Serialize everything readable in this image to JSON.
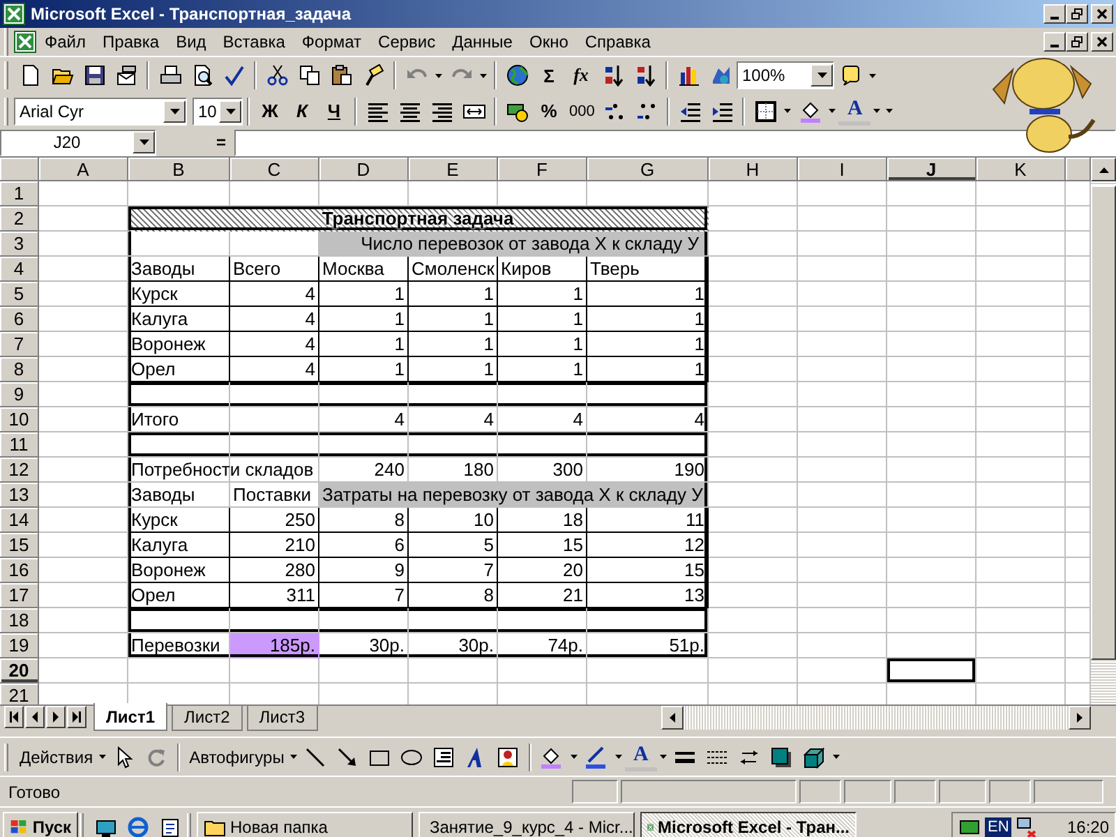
{
  "window": {
    "title": "Microsoft Excel - Транспортная_задача"
  },
  "menu": [
    "Файл",
    "Правка",
    "Вид",
    "Вставка",
    "Формат",
    "Сервис",
    "Данные",
    "Окно",
    "Справка"
  ],
  "standard_toolbar": {
    "sum": "Σ",
    "function": "fx",
    "zoom": "100%"
  },
  "formatting_toolbar": {
    "font": "Arial Cyr",
    "size": "10",
    "bold": "Ж",
    "italic": "К",
    "underline": "Ч",
    "percent": "%",
    "thousands": "000",
    "font_color": "A"
  },
  "formula_bar": {
    "name_box": "J20",
    "equals": "="
  },
  "columns": [
    {
      "label": "A",
      "selected": false
    },
    {
      "label": "B",
      "selected": false
    },
    {
      "label": "C",
      "selected": false
    },
    {
      "label": "D",
      "selected": false
    },
    {
      "label": "E",
      "selected": false
    },
    {
      "label": "F",
      "selected": false
    },
    {
      "label": "G",
      "selected": false
    },
    {
      "label": "H",
      "selected": false
    },
    {
      "label": "I",
      "selected": false
    },
    {
      "label": "J",
      "selected": true
    },
    {
      "label": "K",
      "selected": false
    }
  ],
  "rows": [
    {
      "label": "1",
      "selected": false,
      "kind": "plain",
      "cells": []
    },
    {
      "label": "2",
      "selected": false,
      "kind": "title",
      "cells": [
        {
          "t": "Транспортная задача",
          "kind": "title"
        }
      ]
    },
    {
      "label": "3",
      "selected": false,
      "kind": "total",
      "cells": [
        null,
        null,
        {
          "t": "Число перевозок от завода  Х к складу У",
          "kind": "band"
        }
      ]
    },
    {
      "label": "4",
      "selected": false,
      "kind": "body",
      "cells": [
        {
          "t": "Заводы"
        },
        {
          "t": "Всего"
        },
        {
          "t": "Москва"
        },
        {
          "t": "Смоленск"
        },
        {
          "t": "Киров"
        },
        {
          "t": "Тверь"
        }
      ]
    },
    {
      "label": "5",
      "selected": false,
      "kind": "body",
      "cells": [
        {
          "t": "Курск"
        },
        {
          "t": "4",
          "kind": "number"
        },
        {
          "t": "1",
          "kind": "number"
        },
        {
          "t": "1",
          "kind": "number"
        },
        {
          "t": "1",
          "kind": "number"
        },
        {
          "t": "1",
          "kind": "number"
        }
      ]
    },
    {
      "label": "6",
      "selected": false,
      "kind": "body",
      "cells": [
        {
          "t": "Калуга"
        },
        {
          "t": "4",
          "kind": "number"
        },
        {
          "t": "1",
          "kind": "number"
        },
        {
          "t": "1",
          "kind": "number"
        },
        {
          "t": "1",
          "kind": "number"
        },
        {
          "t": "1",
          "kind": "number"
        }
      ]
    },
    {
      "label": "7",
      "selected": false,
      "kind": "body",
      "cells": [
        {
          "t": "Воронеж"
        },
        {
          "t": "4",
          "kind": "number"
        },
        {
          "t": "1",
          "kind": "number"
        },
        {
          "t": "1",
          "kind": "number"
        },
        {
          "t": "1",
          "kind": "number"
        },
        {
          "t": "1",
          "kind": "number"
        }
      ]
    },
    {
      "label": "8",
      "selected": false,
      "kind": "body",
      "cells": [
        {
          "t": "Орел"
        },
        {
          "t": "4",
          "kind": "number"
        },
        {
          "t": "1",
          "kind": "number"
        },
        {
          "t": "1",
          "kind": "number"
        },
        {
          "t": "1",
          "kind": "number"
        },
        {
          "t": "1",
          "kind": "number"
        }
      ]
    },
    {
      "label": "9",
      "selected": false,
      "kind": "gap",
      "cells": []
    },
    {
      "label": "10",
      "selected": false,
      "kind": "total",
      "cells": [
        {
          "t": "Итого"
        },
        null,
        {
          "t": "4",
          "kind": "number"
        },
        {
          "t": "4",
          "kind": "number"
        },
        {
          "t": "4",
          "kind": "number"
        },
        {
          "t": "4",
          "kind": "number"
        }
      ]
    },
    {
      "label": "11",
      "selected": false,
      "kind": "gap",
      "cells": []
    },
    {
      "label": "12",
      "selected": false,
      "kind": "total",
      "cells": [
        {
          "t": "Потребности складов"
        },
        null,
        {
          "t": "240",
          "kind": "number"
        },
        {
          "t": "180",
          "kind": "number"
        },
        {
          "t": "300",
          "kind": "number"
        },
        {
          "t": "190",
          "kind": "number"
        }
      ]
    },
    {
      "label": "13",
      "selected": false,
      "kind": "total",
      "cells": [
        {
          "t": "Заводы"
        },
        {
          "t": "Поставки"
        },
        {
          "t": "Затраты на перевозку от завода Х к складу У",
          "kind": "band"
        }
      ]
    },
    {
      "label": "14",
      "selected": false,
      "kind": "body",
      "cells": [
        {
          "t": "Курск"
        },
        {
          "t": "250",
          "kind": "number"
        },
        {
          "t": "8",
          "kind": "number"
        },
        {
          "t": "10",
          "kind": "number"
        },
        {
          "t": "18",
          "kind": "number"
        },
        {
          "t": "11",
          "kind": "number"
        }
      ]
    },
    {
      "label": "15",
      "selected": false,
      "kind": "body",
      "cells": [
        {
          "t": "Калуга"
        },
        {
          "t": "210",
          "kind": "number"
        },
        {
          "t": "6",
          "kind": "number"
        },
        {
          "t": "5",
          "kind": "number"
        },
        {
          "t": "15",
          "kind": "number"
        },
        {
          "t": "12",
          "kind": "number"
        }
      ]
    },
    {
      "label": "16",
      "selected": false,
      "kind": "body",
      "cells": [
        {
          "t": "Воронеж"
        },
        {
          "t": "280",
          "kind": "number"
        },
        {
          "t": "9",
          "kind": "number"
        },
        {
          "t": "7",
          "kind": "number"
        },
        {
          "t": "20",
          "kind": "number"
        },
        {
          "t": "15",
          "kind": "number"
        }
      ]
    },
    {
      "label": "17",
      "selected": false,
      "kind": "body",
      "cells": [
        {
          "t": "Орел"
        },
        {
          "t": "311",
          "kind": "number"
        },
        {
          "t": "7",
          "kind": "number"
        },
        {
          "t": "8",
          "kind": "number"
        },
        {
          "t": "21",
          "kind": "number"
        },
        {
          "t": "13",
          "kind": "number"
        }
      ]
    },
    {
      "label": "18",
      "selected": false,
      "kind": "gap",
      "cells": []
    },
    {
      "label": "19",
      "selected": false,
      "kind": "total",
      "cells": [
        {
          "t": "Перевозки"
        },
        {
          "t": "185р.",
          "kind": "number",
          "highlight": true
        },
        {
          "t": "30р.",
          "kind": "number"
        },
        {
          "t": "30р.",
          "kind": "number"
        },
        {
          "t": "74р.",
          "kind": "number"
        },
        {
          "t": "51р.",
          "kind": "number"
        }
      ]
    },
    {
      "label": "20",
      "selected": true,
      "kind": "plain",
      "cells": []
    },
    {
      "label": "21",
      "selected": false,
      "kind": "plain",
      "cells": []
    }
  ],
  "sheet_tabs": [
    {
      "label": "Лист1",
      "selected": true
    },
    {
      "label": "Лист2",
      "selected": false
    },
    {
      "label": "Лист3",
      "selected": false
    }
  ],
  "drawing_toolbar": {
    "actions": "Действия",
    "autoshapes": "Автофигуры",
    "font_color": "A"
  },
  "status_bar": {
    "text": "Готово"
  },
  "taskbar": {
    "start": "Пуск",
    "tasks": [
      {
        "label": "Новая папка",
        "kind": "folder",
        "selected": false
      },
      {
        "label": "Занятие_9_курс_4 - Micr...",
        "kind": "word",
        "selected": false
      },
      {
        "label": "Microsoft Excel - Тран...",
        "kind": "excel",
        "selected": true
      }
    ],
    "language": "EN",
    "clock": "16:20"
  }
}
